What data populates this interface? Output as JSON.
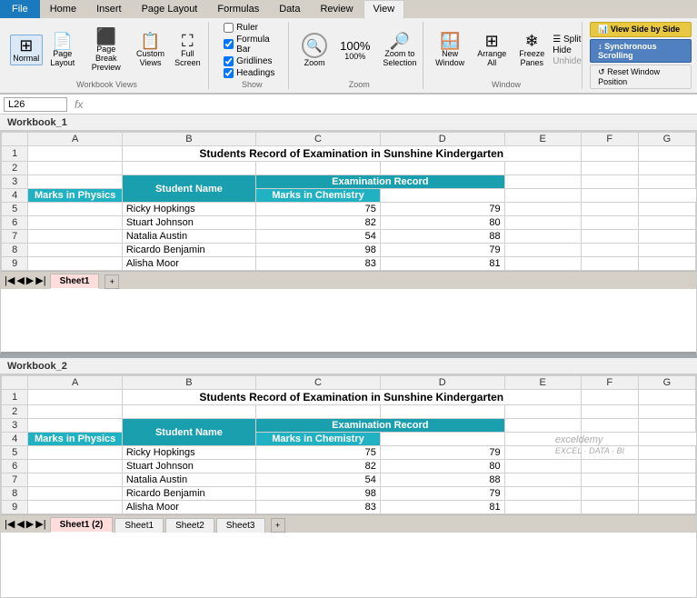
{
  "ribbon": {
    "tabs": [
      "File",
      "Home",
      "Insert",
      "Page Layout",
      "Formulas",
      "Data",
      "Review",
      "View"
    ],
    "active_tab": "View",
    "file_label": "File",
    "groups": {
      "workbook_views": {
        "label": "Workbook Views",
        "buttons": [
          {
            "id": "normal",
            "label": "Normal",
            "active": true
          },
          {
            "id": "page-layout",
            "label": "Page Layout"
          },
          {
            "id": "page-break",
            "label": "Page Break Preview"
          },
          {
            "id": "custom-views",
            "label": "Custom Views"
          },
          {
            "id": "full-screen",
            "label": "Full Screen"
          }
        ]
      },
      "show": {
        "label": "Show",
        "checkboxes": [
          {
            "label": "Ruler",
            "checked": false
          },
          {
            "label": "Formula Bar",
            "checked": true
          },
          {
            "label": "Gridlines",
            "checked": true
          },
          {
            "label": "Headings",
            "checked": true
          }
        ]
      },
      "zoom": {
        "label": "Zoom",
        "buttons": [
          {
            "id": "zoom",
            "label": "Zoom"
          },
          {
            "id": "zoom-100",
            "label": "100%"
          },
          {
            "id": "zoom-selection",
            "label": "Zoom to Selection"
          }
        ]
      },
      "window": {
        "label": "Window",
        "buttons": [
          {
            "id": "new-window",
            "label": "New Window"
          },
          {
            "id": "arrange-all",
            "label": "Arrange All"
          },
          {
            "id": "freeze-panes",
            "label": "Freeze Panes"
          }
        ],
        "right_buttons": [
          {
            "id": "split",
            "label": "Split"
          },
          {
            "id": "hide",
            "label": "Hide"
          },
          {
            "id": "unhide",
            "label": "Unhide"
          }
        ],
        "highlighted_buttons": [
          {
            "id": "view-side-by-side",
            "label": "View Side by Side",
            "color": "gold"
          },
          {
            "id": "synchronous-scrolling",
            "label": "Synchronous Scrolling",
            "color": "blue"
          },
          {
            "id": "reset-window",
            "label": "Reset Window Position"
          }
        ]
      }
    }
  },
  "formula_bar": {
    "name_box": "L26",
    "formula": ""
  },
  "workbook1": {
    "label": "Workbook_1",
    "sheet_tabs": [
      {
        "label": "Sheet1",
        "active": true
      }
    ],
    "title_row": "Students Record of Examination in Sunshine Kindergarten",
    "headers": {
      "student_name": "Student Name",
      "examination_record": "Examination Record",
      "marks_physics": "Marks in Physics",
      "marks_chemistry": "Marks in Chemistry"
    },
    "rows": [
      {
        "name": "Ricky Hopkings",
        "physics": 75,
        "chemistry": 79
      },
      {
        "name": "Stuart Johnson",
        "physics": 82,
        "chemistry": 80
      },
      {
        "name": "Natalia Austin",
        "physics": 54,
        "chemistry": 88
      },
      {
        "name": "Ricardo Benjamin",
        "physics": 98,
        "chemistry": 79
      },
      {
        "name": "Alisha Moor",
        "physics": 83,
        "chemistry": 81
      }
    ]
  },
  "workbook2": {
    "label": "Workbook_2",
    "sheet_tabs": [
      {
        "label": "Sheet1 (2)",
        "active": true
      },
      {
        "label": "Sheet1"
      },
      {
        "label": "Sheet2"
      },
      {
        "label": "Sheet3"
      }
    ],
    "title_row": "Students Record of Examination in Sunshine Kindergarten",
    "headers": {
      "student_name": "Student Name",
      "examination_record": "Examination Record",
      "marks_physics": "Marks in Physics",
      "marks_chemistry": "Marks in Chemistry"
    },
    "rows": [
      {
        "name": "Ricky Hopkings",
        "physics": 75,
        "chemistry": 79
      },
      {
        "name": "Stuart Johnson",
        "physics": 82,
        "chemistry": 80
      },
      {
        "name": "Natalia Austin",
        "physics": 54,
        "chemistry": 88
      },
      {
        "name": "Ricardo Benjamin",
        "physics": 98,
        "chemistry": 79
      },
      {
        "name": "Alisha Moor",
        "physics": 83,
        "chemistry": 81
      }
    ]
  },
  "colors": {
    "header_blue": "#1a9faf",
    "accent_gold": "#e8c840",
    "accent_blue": "#5080c0"
  }
}
